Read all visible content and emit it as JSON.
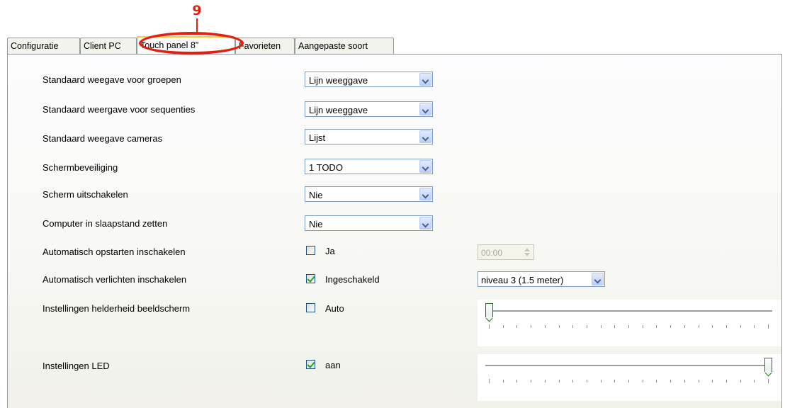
{
  "callout": {
    "number": "9"
  },
  "tabs": [
    {
      "label": "Configuratie",
      "active": false
    },
    {
      "label": "Client PC",
      "active": false
    },
    {
      "label": "Touch panel 8\"",
      "active": true
    },
    {
      "label": "Favorieten",
      "active": false
    },
    {
      "label": "Aangepaste soort",
      "active": false
    }
  ],
  "settings": {
    "groups_view": {
      "label": "Standaard weegave voor groepen",
      "value": "Lijn weeggave"
    },
    "sequences_view": {
      "label": "Standaard weergave voor sequenties",
      "value": "Lijn weeggave"
    },
    "cameras_view": {
      "label": "Standaard weegave cameras",
      "value": "Lijst"
    },
    "screensaver": {
      "label": "Schermbeveiliging",
      "value": "1 TODO"
    },
    "screen_off": {
      "label": "Scherm uitschakelen",
      "value": "Nie"
    },
    "sleep": {
      "label": "Computer in slaapstand zetten",
      "value": "Nie"
    },
    "auto_start": {
      "label": "Automatisch opstarten inschakelen",
      "checkbox_label": "Ja",
      "checked": false,
      "time": "00:00"
    },
    "auto_light": {
      "label": "Automatisch verlichten inschakelen",
      "checkbox_label": "Ingeschakeld",
      "checked": true,
      "level": "niveau 3 (1.5 meter)"
    },
    "brightness": {
      "label": "Instellingen helderheid beeldscherm",
      "checkbox_label": "Auto",
      "checked": false,
      "slider_value": 0
    },
    "led": {
      "label": "Instellingen LED",
      "checkbox_label": "aan",
      "checked": true,
      "slider_value": 1
    }
  },
  "colors": {
    "callout": "#e02010",
    "active_tab_accent": "#ffc83c",
    "check_green": "#21a121"
  }
}
